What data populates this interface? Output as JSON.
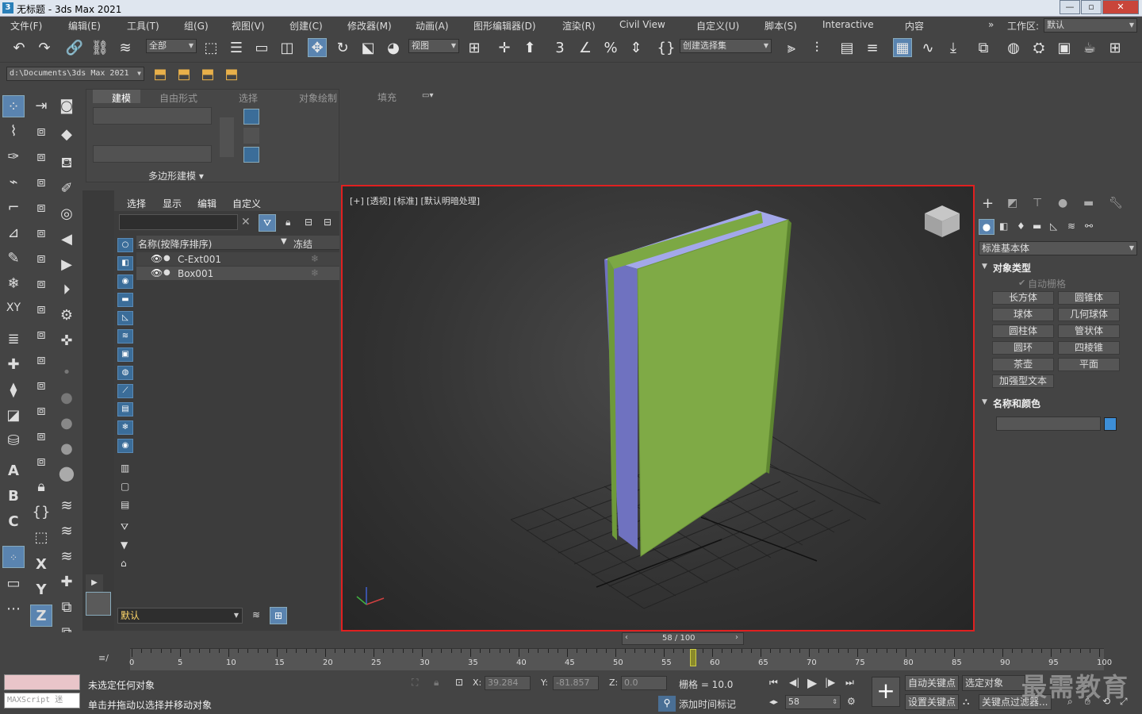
{
  "window": {
    "title": "无标题 - 3ds Max 2021",
    "app_icon": "3",
    "minimize": "—",
    "maximize": "▫",
    "close": "✕"
  },
  "menu": [
    "文件(F)",
    "编辑(E)",
    "工具(T)",
    "组(G)",
    "视图(V)",
    "创建(C)",
    "修改器(M)",
    "动画(A)",
    "图形编辑器(D)",
    "渲染(R)",
    "Civil View",
    "自定义(U)",
    "脚本(S)",
    "Interactive",
    "内容"
  ],
  "workspace": {
    "label": "工作区:",
    "value": "默认",
    "overflow": "»"
  },
  "toolbar": {
    "filter_value": "全部",
    "refcoord_value": "视图",
    "selection_set_value": "创建选择集"
  },
  "path": {
    "value": "d:\\Documents\\3ds Max 2021"
  },
  "ribbon": {
    "tabs": [
      "建模",
      "自由形式",
      "选择",
      "对象绘制",
      "填充"
    ],
    "active_tab": "建模",
    "group_label": "多边形建模 ▾"
  },
  "explorer": {
    "menus": [
      "选择",
      "显示",
      "编辑",
      "自定义"
    ],
    "col_name": "名称(按降序排序)",
    "col_freeze": "冻结",
    "rows": [
      "C-Ext001",
      "Box001"
    ],
    "layer_value": "默认"
  },
  "viewport": {
    "label": "[+] [透视] [标准] [默认明暗处理]"
  },
  "command_panel": {
    "category": "标准基本体",
    "section_object_type": "对象类型",
    "autogrid": "自动栅格",
    "buttons": [
      "长方体",
      "圆锥体",
      "球体",
      "几何球体",
      "圆柱体",
      "管状体",
      "圆环",
      "四棱锥",
      "茶壶",
      "平面",
      "加强型文本"
    ],
    "section_name_color": "名称和颜色",
    "object_color": "#3d8fd8"
  },
  "timeline": {
    "frame_display": "58 / 100",
    "current_frame": 58,
    "total_frames": 100,
    "ticks": [
      "0",
      "5",
      "10",
      "15",
      "20",
      "25",
      "30",
      "35",
      "40",
      "45",
      "50",
      "55",
      "60",
      "65",
      "70",
      "75",
      "80",
      "85",
      "90",
      "95",
      "100"
    ]
  },
  "status": {
    "maxscript": "MAXScript 迷",
    "line1": "未选定任何对象",
    "line2": "单击并拖动以选择并移动对象",
    "x_label": "X:",
    "x": "39.284",
    "y_label": "Y:",
    "y": "-81.857",
    "z_label": "Z:",
    "z": "0.0",
    "grid": "栅格 = 10.0",
    "add_time_tag": "添加时间标记",
    "frame_field": "58",
    "auto_key": "自动关键点",
    "set_key": "设置关键点",
    "selected_obj": "选定对象",
    "key_filters": "关键点过滤器..."
  },
  "watermark": "最需教育",
  "left_labels": [
    "XY",
    "Y",
    "X",
    "Z",
    "A",
    "B",
    "C",
    "XY"
  ]
}
